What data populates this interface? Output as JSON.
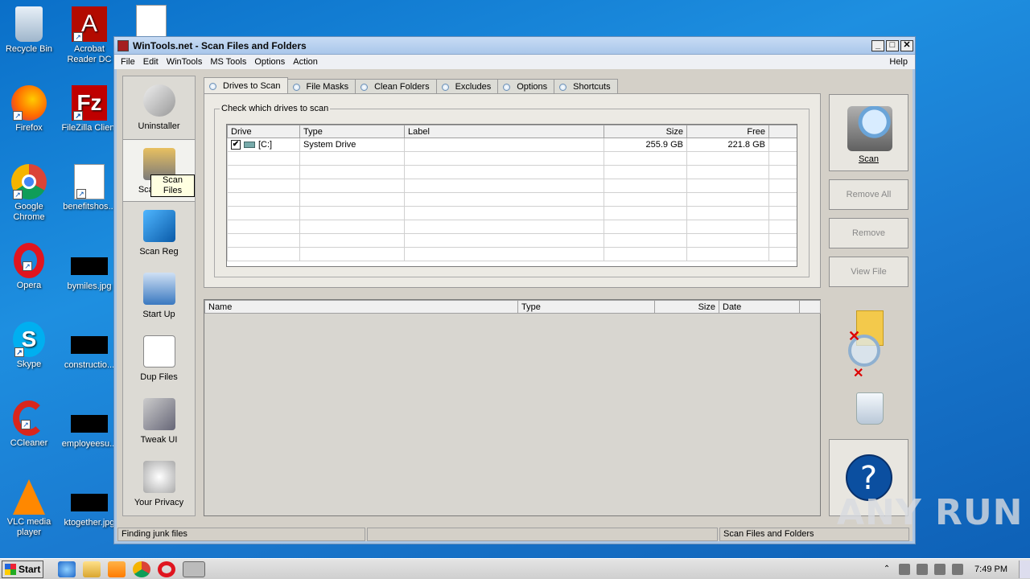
{
  "desktop": {
    "icons_col1": [
      "Recycle Bin",
      "Firefox",
      "Google Chrome",
      "Opera",
      "Skype",
      "CCleaner",
      "VLC media player"
    ],
    "icons_col2": [
      "Acrobat Reader DC",
      "FileZilla Client",
      "benefitshos...",
      "bymiles.jpg",
      "constructio...",
      "employeesu...",
      "ktogether.jpg"
    ]
  },
  "window": {
    "title": "WinTools.net - Scan Files and Folders",
    "menu": [
      "File",
      "Edit",
      "WinTools",
      "MS Tools",
      "Options",
      "Action"
    ],
    "help": "Help"
  },
  "sidebar": {
    "items": [
      "Uninstaller",
      "Scan Files",
      "Scan Reg",
      "Start Up",
      "Dup Files",
      "Tweak UI",
      "Your Privacy"
    ],
    "tooltip": "Scan Files"
  },
  "tabs": [
    "Drives to Scan",
    "File Masks",
    "Clean Folders",
    "Excludes",
    "Options",
    "Shortcuts"
  ],
  "drives": {
    "group_label": "Check which drives to scan",
    "columns": [
      "Drive",
      "Type",
      "Label",
      "Size",
      "Free"
    ],
    "rows": [
      {
        "drive": "[C:]",
        "type": "System Drive",
        "label": "",
        "size": "255.9 GB",
        "free": "221.8 GB",
        "checked": "✔"
      }
    ]
  },
  "results": {
    "columns": [
      "Name",
      "Type",
      "Size",
      "Date"
    ]
  },
  "buttons": {
    "scan": "Scan",
    "remove_all": "Remove All",
    "remove": "Remove",
    "view_file": "View File",
    "help": "?"
  },
  "status": {
    "left": "Finding junk files",
    "middle": "",
    "right": "Scan Files and Folders"
  },
  "taskbar": {
    "start": "Start",
    "clock": "7:49 PM"
  },
  "watermark": "ANY RUN"
}
